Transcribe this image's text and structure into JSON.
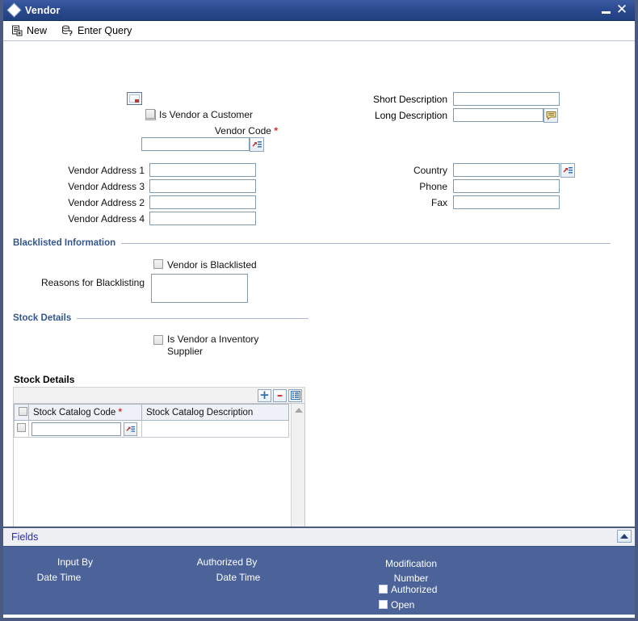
{
  "window": {
    "title": "Vendor",
    "icon": "diamond-icon",
    "minimize_label": "–",
    "close_label": "✕"
  },
  "toolbar": {
    "items": [
      {
        "label": "New",
        "icon": "new-document-icon"
      },
      {
        "label": "Enter Query",
        "icon": "database-query-icon"
      }
    ]
  },
  "form": {
    "vendor_image_icon": "image-placeholder-icon",
    "is_vendor_customer": {
      "label": "Is Vendor a Customer",
      "checked": false
    },
    "vendor_code": {
      "label": "Vendor Code",
      "required": "*",
      "value": "",
      "lov_icon": "lov-icon"
    },
    "short_description": {
      "label": "Short Description",
      "value": ""
    },
    "long_description": {
      "label": "Long Description",
      "value": "",
      "button_icon": "comment-icon"
    },
    "addresses": [
      {
        "label": "Vendor Address 1",
        "value": ""
      },
      {
        "label": "Vendor Address 2",
        "value": ""
      },
      {
        "label": "Vendor Address 3",
        "value": ""
      },
      {
        "label": "Vendor Address 4",
        "value": ""
      }
    ],
    "country": {
      "label": "Country",
      "value": "",
      "lov_icon": "lov-icon"
    },
    "phone": {
      "label": "Phone",
      "value": ""
    },
    "fax": {
      "label": "Fax",
      "value": ""
    }
  },
  "blacklisted_section": {
    "title": "Blacklisted Information",
    "vendor_is_blacklisted": {
      "label": "Vendor is Blacklisted",
      "checked": false
    },
    "reasons": {
      "label": "Reasons for Blacklisting",
      "value": ""
    }
  },
  "stock_section": {
    "title": "Stock Details",
    "is_inventory_supplier": {
      "label": "Is Vendor a Inventory Supplier",
      "checked": false
    }
  },
  "stock_grid": {
    "caption": "Stock Details",
    "toolbar": [
      {
        "name": "add-row-button",
        "glyph": "+"
      },
      {
        "name": "delete-row-button",
        "glyph": "–"
      },
      {
        "name": "grid-view-button",
        "glyph": "grid-icon"
      }
    ],
    "columns": [
      {
        "label": "Stock Catalog Code",
        "required": "*"
      },
      {
        "label": "Stock Catalog Description",
        "required": ""
      }
    ],
    "rows": [
      {
        "stock_catalog_code": "",
        "stock_catalog_description": "",
        "lov_icon": "lov-icon"
      }
    ]
  },
  "fields_bar": {
    "label": "Fields",
    "collapse_icon": "collapse-up-icon"
  },
  "footer": {
    "input_by_label": "Input By",
    "input_date_time_label": "Date Time",
    "authorized_by_label": "Authorized By",
    "authorized_date_time_label": "Date Time",
    "modification_number_label": "Modification Number",
    "authorized": {
      "label": "Authorized",
      "checked": false
    },
    "open": {
      "label": "Open",
      "checked": false
    }
  },
  "colors": {
    "titlebar": "#2c4a8f",
    "footer": "#4b6399",
    "window_border": "#4b5a80",
    "section_title": "#33568f",
    "required_marker": "#d32f2f",
    "link": "#2b2bb5",
    "input_border": "#7e9ab0"
  }
}
